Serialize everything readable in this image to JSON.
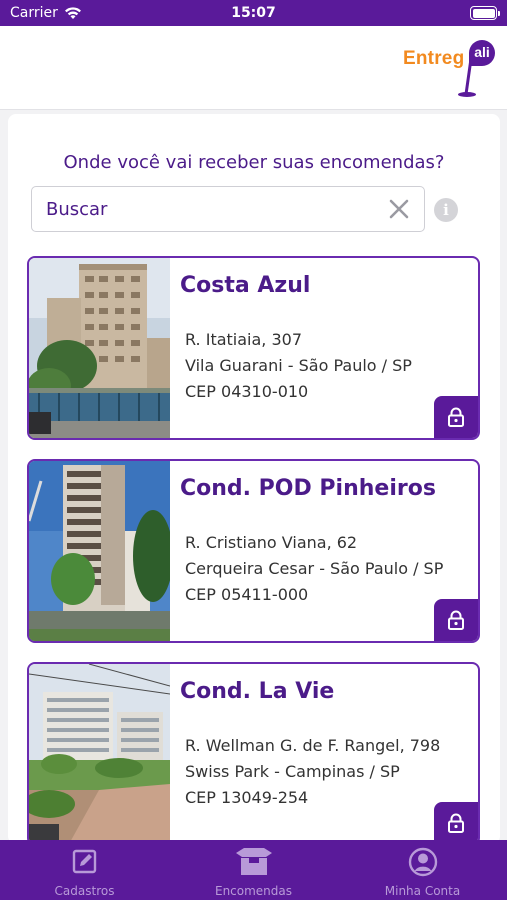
{
  "status_bar": {
    "carrier": "Carrier",
    "time": "15:07"
  },
  "header": {
    "logo_text": "Entreg",
    "logo_flag": "ali"
  },
  "prompt": "Onde você vai receber suas encomendas?",
  "search": {
    "value": "Buscar",
    "placeholder": "Buscar"
  },
  "info_label": "i",
  "condos": [
    {
      "name": "Costa Azul",
      "street": "R. Itatiaia, 307",
      "district": "Vila Guarani - São Paulo / SP",
      "cep": "CEP 04310-010",
      "locked": true
    },
    {
      "name": "Cond. POD Pinheiros",
      "street": "R. Cristiano Viana, 62",
      "district": "Cerqueira Cesar - São Paulo / SP",
      "cep": "CEP 05411-000",
      "locked": true
    },
    {
      "name": "Cond. La Vie",
      "street": "R. Wellman G. de F. Rangel, 798",
      "district": "Swiss Park - Campinas / SP",
      "cep": "CEP 13049-254",
      "locked": true
    }
  ],
  "tabs": [
    {
      "label": "Cadastros",
      "icon": "edit-icon"
    },
    {
      "label": "Encomendas",
      "icon": "box-icon"
    },
    {
      "label": "Minha Conta",
      "icon": "account-icon"
    }
  ],
  "colors": {
    "brand_purple": "#5a1a9a",
    "title_purple": "#4b1b89",
    "logo_orange": "#f28a1f",
    "tab_inactive": "#b89ad8"
  }
}
